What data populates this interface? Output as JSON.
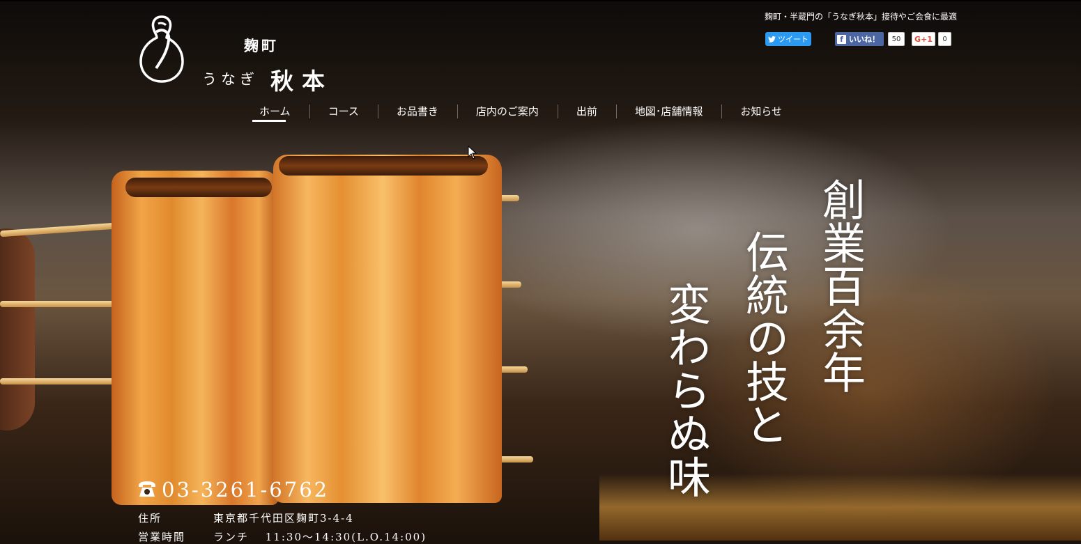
{
  "site": {
    "logo_sub": "麹町",
    "logo_una": "うなぎ",
    "logo_name": "秋本",
    "tagline": "麹町・半蔵門の「うなぎ秋本」接待やご会食に最適"
  },
  "social": {
    "tweet_label": "ツイート",
    "like_label": "いいね！",
    "like_count": "50",
    "gplus_label": "G+1",
    "gplus_count": "0"
  },
  "nav": {
    "items": [
      {
        "label": "ホーム",
        "active": true
      },
      {
        "label": "コース"
      },
      {
        "label": "お品書き"
      },
      {
        "label": "店内のご案内"
      },
      {
        "label": "出前"
      },
      {
        "label": "地図･店舗情報"
      },
      {
        "label": "お知らせ"
      }
    ]
  },
  "hero": {
    "lines": [
      "創業百余年",
      "伝統の技と",
      "変わらぬ味"
    ]
  },
  "contact": {
    "phone": "03-3261-6762",
    "address_label": "住所",
    "address": "東京都千代田区麹町3-4-4",
    "hours_label": "営業時間",
    "hours": "ランチ　 11:30～14:30(L.O.14:00)"
  },
  "colors": {
    "accent": "#ffffff",
    "twitter": "#2b9af3",
    "facebook": "#4c66a4",
    "gplus": "#dd4b39"
  }
}
